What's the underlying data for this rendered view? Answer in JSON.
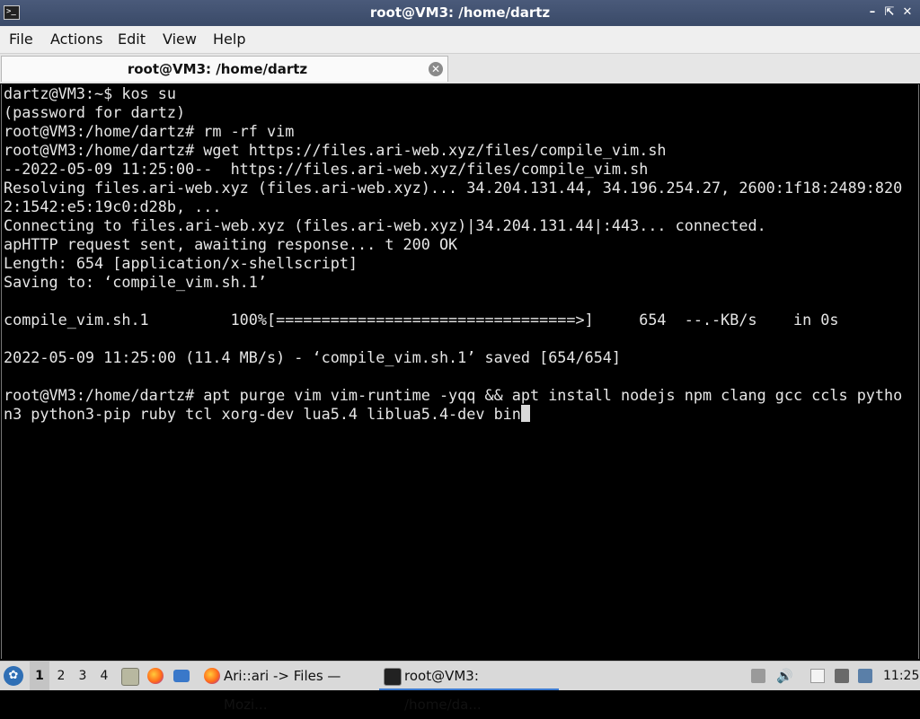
{
  "window": {
    "title": "root@VM3: /home/dartz",
    "app_icon": "terminal-icon",
    "controls": [
      "minimize",
      "maximize",
      "close"
    ]
  },
  "menubar": {
    "items": [
      "File",
      "Actions",
      "Edit",
      "View",
      "Help"
    ]
  },
  "tabs": [
    {
      "label": "root@VM3: /home/dartz",
      "active": true,
      "close_icon": "close-icon"
    }
  ],
  "terminal": {
    "lines": [
      "dartz@VM3:~$ kos su",
      "(password for dartz)",
      "root@VM3:/home/dartz# rm -rf vim",
      "root@VM3:/home/dartz# wget https://files.ari-web.xyz/files/compile_vim.sh",
      "--2022-05-09 11:25:00--  https://files.ari-web.xyz/files/compile_vim.sh",
      "Resolving files.ari-web.xyz (files.ari-web.xyz)... 34.204.131.44, 34.196.254.27, 2600:1f18:2489:820",
      "2:1542:e5:19c0:d28b, ...",
      "Connecting to files.ari-web.xyz (files.ari-web.xyz)|34.204.131.44|:443... connected.",
      "apHTTP request sent, awaiting response... t 200 OK",
      "Length: 654 [application/x-shellscript]",
      "Saving to: ‘compile_vim.sh.1’",
      "",
      "compile_vim.sh.1         100%[=================================>]     654  --.-KB/s    in 0s",
      "",
      "2022-05-09 11:25:00 (11.4 MB/s) - ‘compile_vim.sh.1’ saved [654/654]",
      "",
      "root@VM3:/home/dartz# apt purge vim vim-runtime -yqq && apt install nodejs npm clang gcc ccls pytho",
      "n3 python3-pip ruby tcl xorg-dev lua5.4 liblua5.4-dev bin"
    ]
  },
  "taskbar": {
    "workspaces": [
      "1",
      "2",
      "3",
      "4"
    ],
    "active_workspace": "1",
    "launchers": [
      "file-manager-icon",
      "firefox-icon",
      "desktop-icon"
    ],
    "tasks": [
      {
        "label": "Ari::ari -> Files — Mozi...",
        "icon": "firefox-icon",
        "active": false
      },
      {
        "label": "root@VM3: /home/da...",
        "icon": "terminal-icon",
        "active": true
      }
    ],
    "tray": [
      "screenshot-icon",
      "volume-icon",
      "clipboard-icon",
      "network-icon",
      "monitor-icon"
    ],
    "clock": "11:25"
  },
  "colors": {
    "titlebar": "#3f4f6f",
    "terminal_bg": "#000000",
    "terminal_fg": "#e6e6e6",
    "taskbar": "#d9d9d9",
    "accent": "#3d7bd1"
  }
}
